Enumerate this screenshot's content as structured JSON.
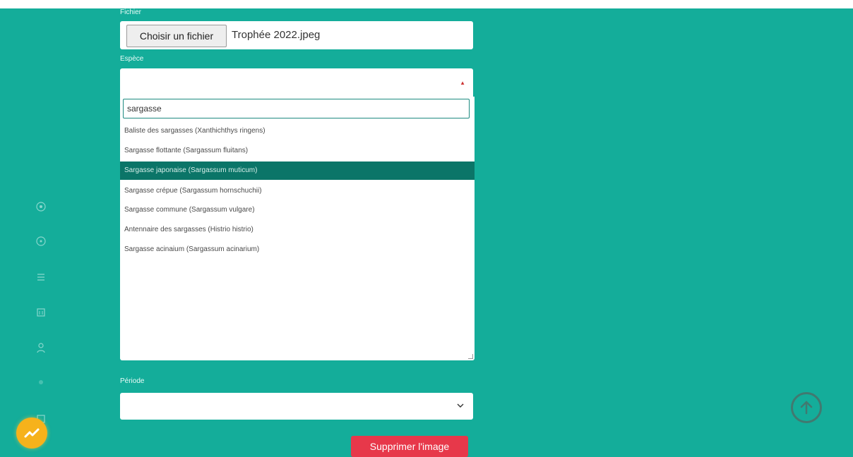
{
  "form": {
    "file_label": "Fichier",
    "file_button": "Choisir un fichier",
    "file_name": "Trophée 2022.jpeg",
    "species_label": "Espèce",
    "search_value": "sargasse",
    "options": [
      "Baliste des sargasses (Xanthichthys ringens)",
      "Sargasse flottante (Sargassum fluitans)",
      "Sargasse japonaise (Sargassum muticum)",
      "Sargasse crépue (Sargassum hornschuchii)",
      "Sargasse commune (Sargassum vulgare)",
      "Antennaire des sargasses (Histrio histrio)",
      "Sargasse acinaium (Sargassum acinarium)"
    ],
    "selected_index": 2,
    "period_label": "Période",
    "period_value": "",
    "delete_button": "Supprimer l'image"
  },
  "sidebar": {
    "icons": [
      "home-icon",
      "compass-icon",
      "menu-icon",
      "calendar-icon",
      "user-icon",
      "info-icon",
      "grid-icon"
    ]
  },
  "colors": {
    "background": "#14ad9a",
    "selected_option": "#0b7568",
    "delete_button": "#e7384a",
    "avatar": "#f6b21b"
  }
}
